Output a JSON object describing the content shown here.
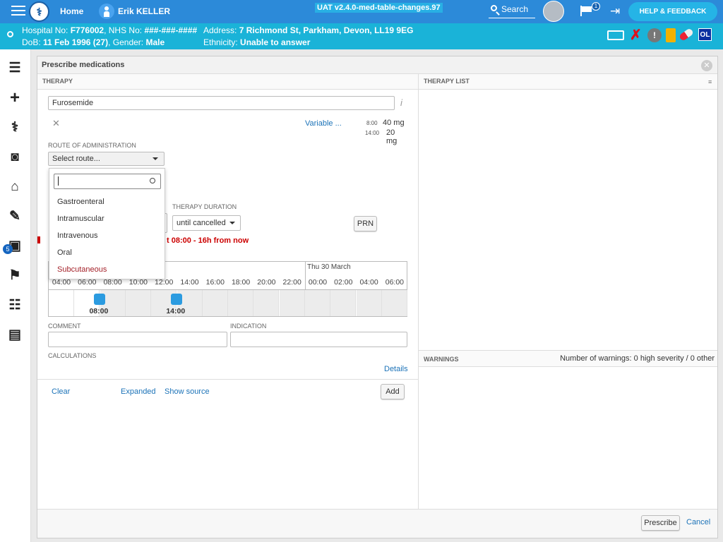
{
  "topbar": {
    "home": "Home",
    "patient_name": "Erik KELLER",
    "environment": "UAT v2.4.0-med-table-changes.97",
    "search": "Search",
    "notifications_count": "1",
    "help": "HELP & FEEDBACK"
  },
  "patient": {
    "hospital_no_label": "Hospital No:",
    "hospital_no": "F776002",
    "nhs_label": "NHS No:",
    "nhs": "###-###-####",
    "address_label": "Address:",
    "address": "7 Richmond St, Parkham, Devon, LL19 9EG",
    "dob_label": "DoB:",
    "dob": "11 Feb 1996 (27)",
    "gender_label": "Gender:",
    "gender": "Male",
    "ethnicity_label": "Ethnicity:",
    "ethnicity": "Unable to answer",
    "ol_badge": "OL"
  },
  "sidebar": {
    "inbox_badge": "5"
  },
  "modal": {
    "title": "Prescribe medications",
    "therapy_header": "THERAPY",
    "therapy_list_header": "THERAPY LIST",
    "warnings_header": "WARNINGS",
    "warnings_summary": "Number of warnings: 0 high severity / 0 other",
    "medication": "Furosemide",
    "variable_link": "Variable ...",
    "doses": [
      {
        "time": "8:00",
        "amount": "40 mg"
      },
      {
        "time": "14:00",
        "amount": "20 mg"
      }
    ],
    "route_label": "ROUTE OF ADMINISTRATION",
    "route_placeholder": "Select route...",
    "route_options": [
      "Gastroenteral",
      "Intramuscular",
      "Intravenous",
      "Oral",
      "Subcutaneous"
    ],
    "duration_label": "THERAPY DURATION",
    "duration_value": "until cancelled",
    "prn": "PRN",
    "start_text": "t 08:00 - 16h from now",
    "timeline_day": "Thu 30 March",
    "timeline_hours": [
      "04:00",
      "06:00",
      "08:00",
      "10:00",
      "12:00",
      "14:00",
      "16:00",
      "18:00",
      "20:00",
      "22:00",
      "00:00",
      "02:00",
      "04:00",
      "06:00"
    ],
    "timeline_doses": [
      "08:00",
      "14:00"
    ],
    "comment_label": "COMMENT",
    "indication_label": "INDICATION",
    "calculations_label": "CALCULATIONS",
    "details": "Details",
    "clear": "Clear",
    "expanded": "Expanded",
    "show_source": "Show source",
    "add": "Add",
    "prescribe": "Prescribe",
    "cancel": "Cancel"
  },
  "colors": {
    "topbar": "#2c8ad9",
    "patient_bar": "#1ab3d8",
    "link": "#1c73b8",
    "warning_red": "#cc0000"
  }
}
